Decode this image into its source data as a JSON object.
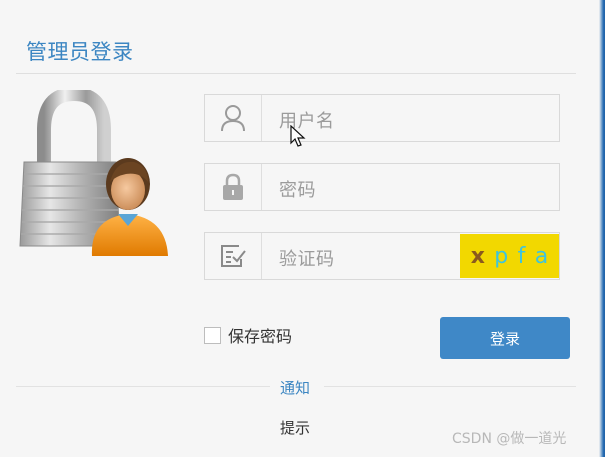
{
  "page": {
    "title": "管理员登录"
  },
  "form": {
    "username_placeholder": "用户名",
    "password_placeholder": "密码",
    "captcha_placeholder": "验证码",
    "captcha_chars": [
      "x",
      "p",
      "f",
      "a"
    ],
    "remember_label": "保存密码",
    "remember_checked": false,
    "login_label": "登录"
  },
  "notice": {
    "title": "通知",
    "body": "提示"
  },
  "watermark": "CSDN @做一道光",
  "colors": {
    "accent": "#3c86c2",
    "button": "#3f88c7",
    "captcha_bg": "#f2d800"
  },
  "icons": [
    "padlock-user-icon",
    "user-icon",
    "lock-icon",
    "verify-icon",
    "mouse-cursor-icon"
  ]
}
